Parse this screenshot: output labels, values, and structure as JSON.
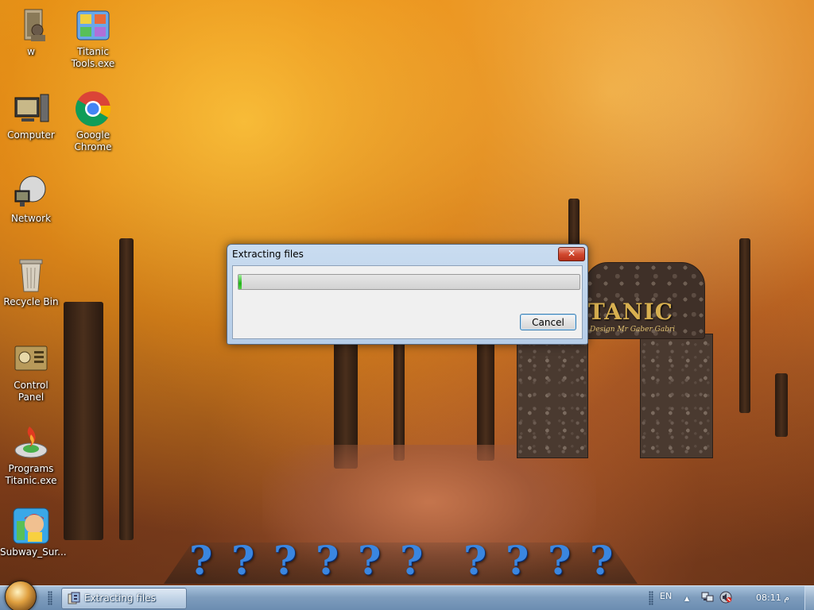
{
  "desktop": {
    "icons": [
      {
        "label": "w",
        "icon": "user-folder-icon"
      },
      {
        "label": "Titanic Tools.exe",
        "icon": "titanic-tools-icon"
      },
      {
        "label": "Computer",
        "icon": "computer-icon"
      },
      {
        "label": "Google Chrome",
        "icon": "chrome-icon"
      },
      {
        "label": "Network",
        "icon": "network-icon"
      },
      {
        "label": "Recycle Bin",
        "icon": "recycle-bin-icon"
      },
      {
        "label": "Control Panel",
        "icon": "control-panel-icon"
      },
      {
        "label": "Programs Titanic.exe",
        "icon": "programs-titanic-icon"
      },
      {
        "label": "Subway_Sur...",
        "icon": "subway-surfers-icon"
      }
    ],
    "wallpaper_text": {
      "brand": "TANIC",
      "subtitle": "Design Mr Gaber Gabri"
    },
    "dock": {
      "glyph": "?",
      "count": 10,
      "color": "#3a86e0"
    }
  },
  "dialog": {
    "title": "Extracting files",
    "close_label": "✕",
    "progress": 0.01,
    "cancel_label": "Cancel"
  },
  "taskbar": {
    "active_task_label": "Extracting files",
    "language": "EN",
    "clock": "08:11 م",
    "tray_expand_glyph": "▲"
  },
  "colors": {
    "accent": "#3c7fb1",
    "close_button": "#d24a30",
    "progress_fill": "#22b418"
  }
}
